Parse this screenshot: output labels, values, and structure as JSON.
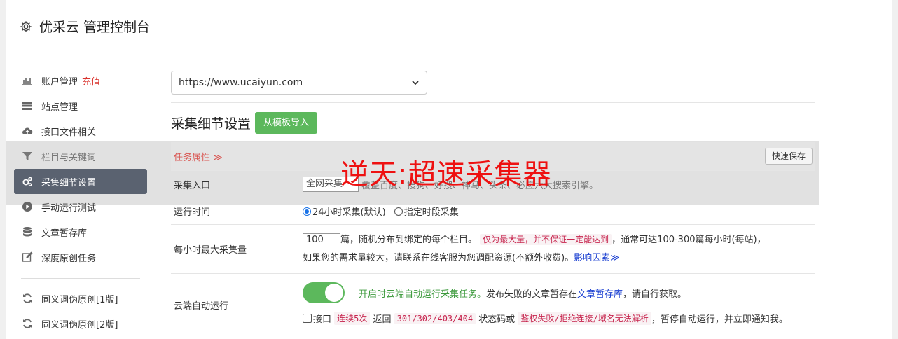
{
  "header": {
    "title": "优采云 管理控制台",
    "icon": "gear-icon"
  },
  "sidebar": {
    "items": [
      {
        "label": "账户管理",
        "badge": "充值",
        "icon": "bar-chart-icon"
      },
      {
        "label": "站点管理",
        "icon": "server-icon"
      },
      {
        "label": "接口文件相关",
        "icon": "cloud-upload-icon"
      },
      {
        "label": "栏目与关键词",
        "icon": "filter-icon"
      },
      {
        "label": "采集细节设置",
        "icon": "cogs-icon",
        "active": true
      },
      {
        "label": "手动运行测试",
        "icon": "play-circle-icon"
      },
      {
        "label": "文章暂存库",
        "icon": "database-icon"
      },
      {
        "label": "深度原创任务",
        "icon": "edit-icon"
      },
      {
        "label": "同义词伪原创[1版]",
        "icon": "refresh-icon"
      },
      {
        "label": "同义词伪原创[2版]",
        "icon": "refresh-icon"
      }
    ]
  },
  "main": {
    "site_select": "https://www.ucaiyun.com",
    "section_title": "采集细节设置",
    "import_button": "从模板导入",
    "tab_label": "任务属性 ≫",
    "quick_save": "快速保存",
    "rows": {
      "entry": {
        "label": "采集入口",
        "input": "全网采集",
        "desc": "覆盖百度、搜狗、好搜、神马、头条、必应六大搜索引擎。"
      },
      "time": {
        "label": "运行时间",
        "opt1": "24小时采集(默认)",
        "opt2": "指定时段采集"
      },
      "max": {
        "label": "每小时最大采集量",
        "value": "100",
        "t1": "篇，随机分布到绑定的每个栏目。",
        "code": "仅为最大量，并不保证一定能达到",
        "t2": "，通常可达100-300篇每小时(每站)，",
        "t3": "如果您的需求量较大，请联系在线客服为您调配资源(不额外收费)。",
        "link": "影响因素≫"
      },
      "cloud": {
        "label": "云端自动运行",
        "green": "开启时云端自动运行采集任务。",
        "t1": "发布失败的文章暂存在",
        "link": "文章暂存库",
        "t2": "，请自行获取。",
        "iface": "接口",
        "c1": "连续5次",
        "t3": "返回",
        "c2": "301/302/403/404",
        "t4": "状态码或",
        "c3": "鉴权失败/拒绝连接/域名无法解析",
        "t5": "，暂停自动运行，并立即通知我。"
      }
    }
  },
  "watermark": "逆天:超速采集器"
}
